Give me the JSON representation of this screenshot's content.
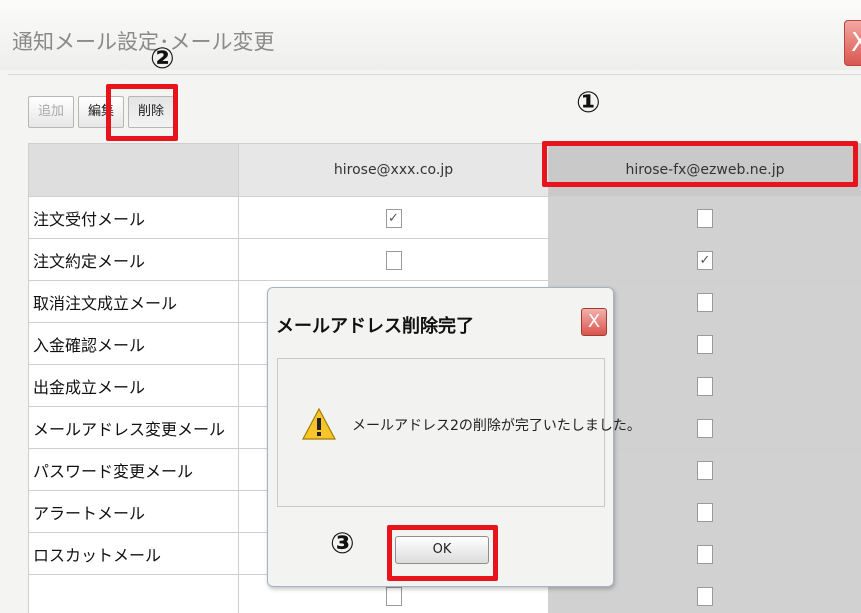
{
  "window": {
    "title": "通知メール設定･メール変更",
    "close_label": "X"
  },
  "toolbar": {
    "add_label": "追加",
    "edit_label": "編集",
    "delete_label": "削除"
  },
  "grid": {
    "columns": [
      "",
      "hirose@xxx.co.jp",
      "hirose-fx@ezweb.ne.jp"
    ],
    "rows": [
      {
        "label": "注文受付メール",
        "col1": true,
        "col2": false
      },
      {
        "label": "注文約定メール",
        "col1": false,
        "col2": true
      },
      {
        "label": "取消注文成立メール",
        "col1": null,
        "col2": false
      },
      {
        "label": "入金確認メール",
        "col1": null,
        "col2": false
      },
      {
        "label": "出金成立メール",
        "col1": null,
        "col2": false
      },
      {
        "label": "メールアドレス変更メール",
        "col1": null,
        "col2": false
      },
      {
        "label": "パスワード変更メール",
        "col1": null,
        "col2": false
      },
      {
        "label": "アラートメール",
        "col1": null,
        "col2": false
      },
      {
        "label": "ロスカットメール",
        "col1": null,
        "col2": false
      },
      {
        "label": "",
        "col1": false,
        "col2": false
      }
    ]
  },
  "dialog": {
    "title": "メールアドレス削除完了",
    "close_label": "X",
    "message": "メールアドレス2の削除が完了いたしました。",
    "ok_label": "OK",
    "icon": "warning-icon"
  },
  "annotations": {
    "marker1": "①",
    "marker2": "②",
    "marker3": "③",
    "highlight_color": "#e8141b"
  }
}
